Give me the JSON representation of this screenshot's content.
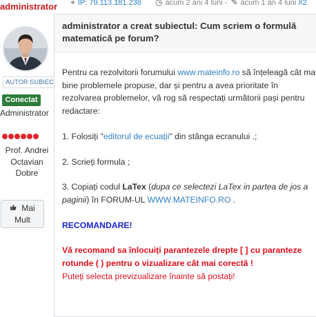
{
  "user": {
    "username": "administrator",
    "author_badge": "AUTOR SUBIECT",
    "online_status": "Conectat",
    "role": "Administrator",
    "rank_dots": 6,
    "rank_color": "#e0262c",
    "real_name": "Prof. Andrei Octavian Dobre",
    "more_button": "Mai Mult"
  },
  "meta": {
    "ip": "IP: 79.113.181.236",
    "created": "acum 2 ani 4 luni -",
    "edited": "acum 1 an 4 luni",
    "post_number": "#2"
  },
  "post": {
    "title": "administrator a creat subiectul: Cum scriem o formulă matematică pe forum?",
    "intro_1": "Pentru ca rezolvitorii forumului ",
    "site_link": "www.mateinfo.ro",
    "intro_2": " să înțeleagă cât mai bine problemele propuse, dar și pentru a avea prioritate în rezolvarea problemelor, vă rog să respectați următorii pași pentru redactare:",
    "step1_a": "1. Folosiți \"",
    "step1_link": "editorul de ecuații",
    "step1_b": "\" din stânga ecranului .;",
    "step2": "2. Scrieți formula ;",
    "step3_a": "3. Copiați codul ",
    "step3_bold": "LaTex",
    "step3_b": " (",
    "step3_em": "dupa ce selectezi LaTex in partea de jos a paginii",
    "step3_c": ") în FORUM-UL ",
    "step3_link": "WWW.MATEINFO.RO",
    "step3_d": " .",
    "recommend": "RECOMANDARE!",
    "warning": "Vă recomand sa înlocuiți parantezele drepte [ ] cu paranteze rotunde ( ) pentru o vizualizare cât mai corectă !",
    "tip": "Puteți selecta previzualizare înainte să postați!"
  },
  "colors": {
    "username": "#c71d1d",
    "online": "#2e7d3a",
    "link": "#2f80c6",
    "recommend": "#1a24c9",
    "warning": "#e0101c"
  },
  "icons": [
    "map-marker-icon",
    "clock-icon",
    "edit-icon",
    "thumbs-up-icon"
  ]
}
